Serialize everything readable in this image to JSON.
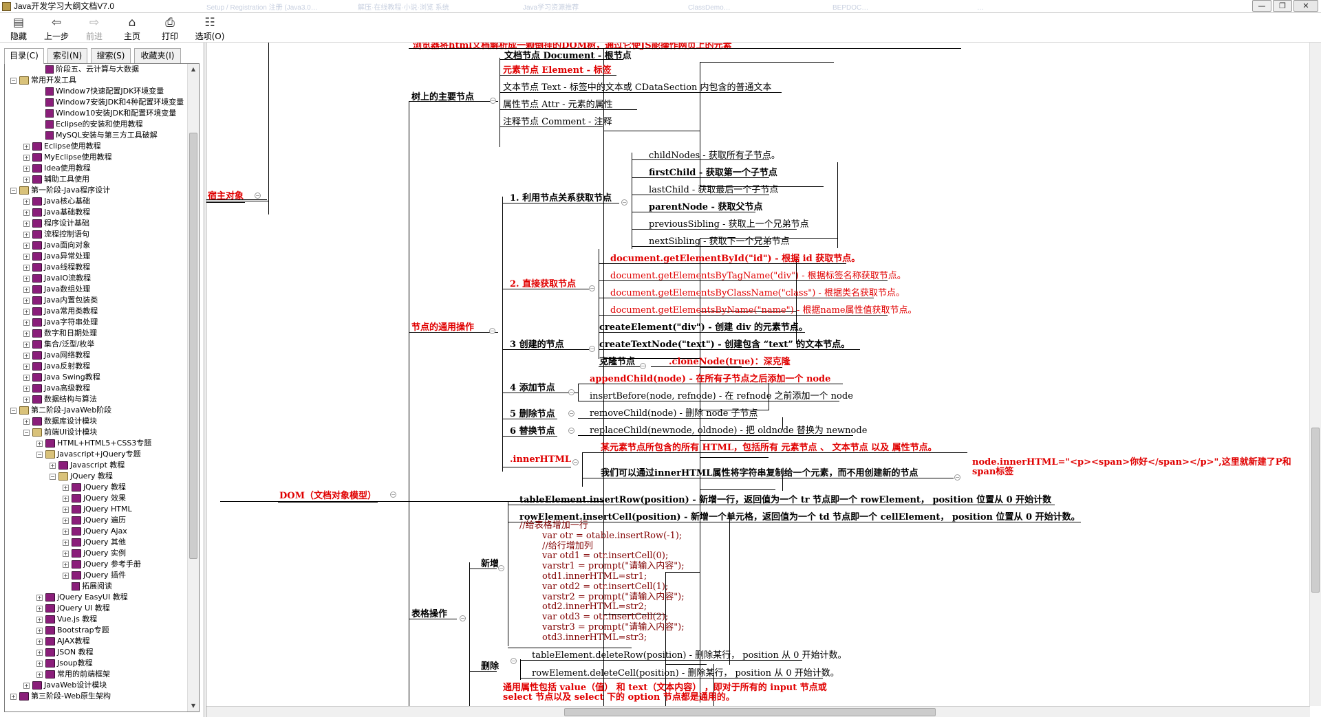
{
  "window": {
    "title": "Java开发学习大纲文档V7.0",
    "controls": [
      "—",
      "❐",
      "✕"
    ],
    "ghost_tabs": [
      "Setup / Registration 注册 (Java3.0…",
      "解压·在线教程·小说·浏览 系统",
      "Java学习资源推荐",
      "ClassDemo…",
      "BEPDOC…",
      "…"
    ]
  },
  "toolbar": {
    "hide": "隐藏",
    "back": "上一步",
    "forward": "前进",
    "home": "主页",
    "print": "打印",
    "options": "选项(O)"
  },
  "tabs": [
    "目录(C)",
    "索引(N)",
    "搜索(S)",
    "收藏夹(I)"
  ],
  "tree": [
    "阶段五、云计算与大数据",
    "常用开发工具",
    "Window7快速配置JDK环境变量",
    "Window7安装JDK和4种配置环境变量",
    "Window10安装JDK和配置环境变量",
    "Eclipse的安装和使用教程",
    "MySQL安装与第三方工具破解",
    "Eclipse使用教程",
    "MyEclipse使用教程",
    "Idea使用教程",
    "辅助工具使用",
    "第一阶段-Java程序设计",
    "Java核心基础",
    "Java基础教程",
    "程序设计基础",
    "流程控制语句",
    "Java面向对象",
    "Java异常处理",
    "Java线程教程",
    "JavaIO流教程",
    "Java数组处理",
    "Java内置包装类",
    "Java常用类教程",
    "Java字符串处理",
    "数字和日期处理",
    "集合/泛型/枚举",
    "Java网络教程",
    "Java反射教程",
    "Java Swing教程",
    "Java高级教程",
    "数据结构与算法",
    "第二阶段-JavaWeb阶段",
    "数据库设计模块",
    "前端UI设计模块",
    "HTML+HTML5+CSS3专题",
    "Javascript+jQuery专题",
    "Javascript 教程",
    "jQuery 教程",
    "jQuery 教程",
    "jQuery 效果",
    "jQuery HTML",
    "jQuery 遍历",
    "jQuery Ajax",
    "jQuery 其他",
    "jQuery 实例",
    "jQuery 参考手册",
    "jQuery 插件",
    "拓展阅读",
    "jQuery EasyUI 教程",
    "jQuery UI 教程",
    "Vue.js 教程",
    "Bootstrap专题",
    "AJAX教程",
    "JSON 教程",
    "Jsoup教程",
    "常用的前端框架",
    "JavaWeb设计模块",
    "第三阶段-Web原生架构"
  ],
  "mindmap": {
    "host": "宿主对象",
    "dom": "DOM（文档对象模型）",
    "top_note": "浏览器将html文档解析成一颗倒挂的DOM树，通过它使JS能操作网页上的元素",
    "tree_nodes": {
      "label": "树上的主要节点",
      "items": [
        "文档节点 Document - 根节点",
        "元素节点 Element - 标签",
        "文本节点 Text - 标签中的文本或 CDataSection 内包含的普通文本",
        "属性节点 Attr - 元素的属性",
        "注释节点 Comment - 注释"
      ]
    },
    "common_ops": "节点的通用操作",
    "relation": {
      "label": "1. 利用节点关系获取节点",
      "items": [
        "childNodes - 获取所有子节点。",
        "firstChild - 获取第一个子节点",
        "lastChild - 获取最后一个子节点",
        "parentNode - 获取父节点",
        "previousSibling - 获取上一个兄弟节点",
        "nextSibling - 获取下一个兄弟节点"
      ]
    },
    "direct": {
      "label": "2. 直接获取节点",
      "items": [
        "document.getElementById(\"id\") - 根据 id 获取节点。",
        "document.getElementsByTagName(\"div\") - 根据标签名称获取节点。",
        "document.getElementsByClassName(\"class\") - 根据类名获取节点。",
        "document.getElementsByName(\"name\") - 根据name属性值获取节点。"
      ]
    },
    "create": {
      "label": "3 创建的节点",
      "items": [
        "createElement(\"div\") - 创建 div 的元素节点。",
        "createTextNode(\"text\") - 创建包含 “text” 的文本节点。"
      ],
      "clone_label": "克隆节点",
      "clone_item": ".cloneNode(true)：深克隆"
    },
    "add": {
      "label": "4 添加节点",
      "items": [
        "appendChild(node) - 在所有子节点之后添加一个 node",
        "insertBefore(node, refnode) - 在 refnode 之前添加一个 node"
      ]
    },
    "remove": {
      "label": "5 删除节点",
      "item": "removeChild(node) - 删除 node 子节点"
    },
    "replace": {
      "label": "6 替换节点",
      "item": "replaceChild(newnode, oldnode) - 把 oldnode 替换为 newnode"
    },
    "inner": {
      "label": ".innerHTML",
      "item1": "某元素节点所包含的所有 HTML，包括所有 元素节点 、 文本节点 以及 属性节点。",
      "item2": "我们可以通过innerHTML属性将字符串复制给一个元素，而不用创建新的节点",
      "example": "node.innerHTML=\"<p><span>你好</span></p>\",这里就新建了P和span标签"
    },
    "table": {
      "label": "表格操作",
      "add_label": "新增",
      "add_items": [
        "tableElement.insertRow(position) - 新增一行，返回值为一个 tr 节点即一个 rowElement， position 位置从 0 开始计数",
        "rowElement.insertCell(position) - 新增一个单元格，返回值为一个 td 节点即一个 cellElement， position 位置从 0 开始计数。"
      ],
      "code": "//给表格增加一行\n        var otr = otable.insertRow(-1);\n        //给行增加列\n        var otd1 = otr.insertCell(0);\n        varstr1 = prompt(\"请输入内容\");\n        otd1.innerHTML=str1;\n        var otd2 = otr.insertCell(1);\n        varstr2 = prompt(\"请输入内容\");\n        otd2.innerHTML=str2;\n        var otd3 = otr.insertCell(2);\n        varstr3 = prompt(\"请输入内容\");\n        otd3.innerHTML=str3;",
      "del_label": "删除",
      "del_items": [
        "tableElement.deleteRow(position) - 删除某行， position 从 0 开始计数。",
        "rowElement.deleteCell(position) - 删除某行， position 从 0 开始计数。"
      ]
    },
    "bottom_note": "通用属性包括 value（值） 和 text（文本内容） ，即对于所有的 input 节点或 select 节点以及 select 下的 option 节点都是通用的。"
  }
}
